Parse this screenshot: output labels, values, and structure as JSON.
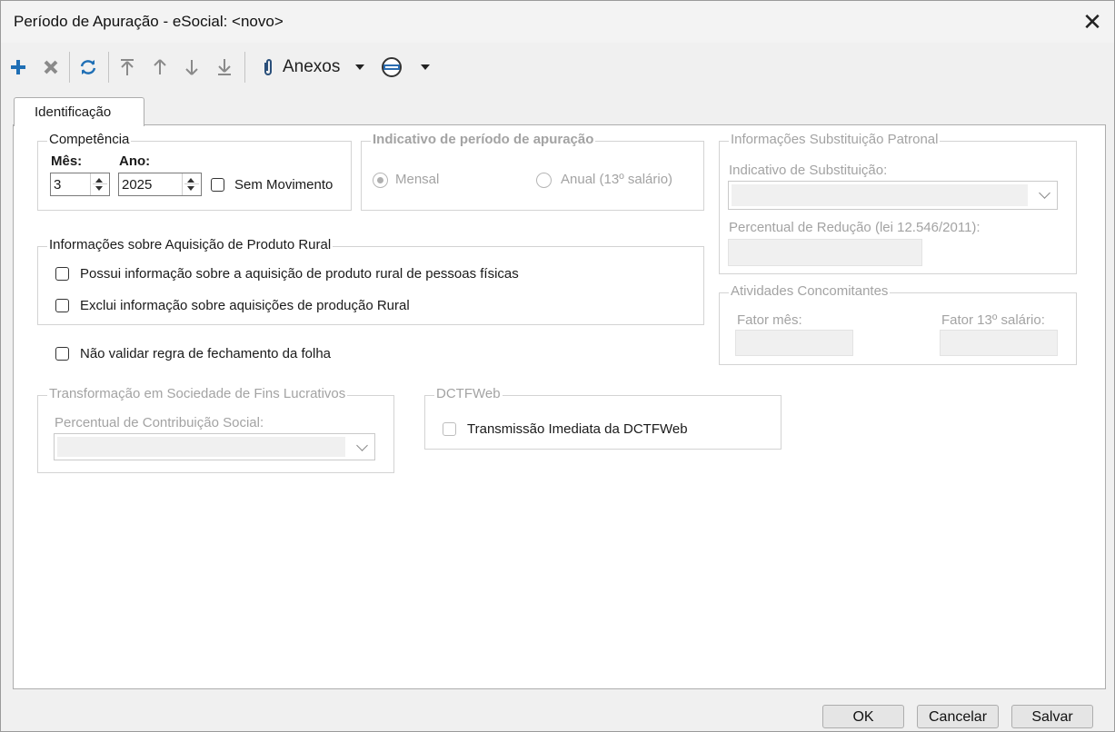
{
  "window": {
    "title": "Período de Apuração - eSocial: <novo>"
  },
  "toolbar": {
    "add_icon": "plus-icon",
    "delete_icon": "x-icon",
    "refresh_icon": "refresh-icon",
    "nav_icons": [
      "first-icon",
      "prev-icon",
      "next-icon",
      "last-icon"
    ],
    "anexos_label": "Anexos",
    "colors": {
      "add": "#1f6fb5",
      "refresh": "#1f6fb5"
    }
  },
  "tabs": [
    {
      "label": "Identificação",
      "active": true
    }
  ],
  "competencia": {
    "legend": "Competência",
    "mes_label": "Mês:",
    "mes_value": "3",
    "ano_label": "Ano:",
    "ano_value": "2025",
    "sem_movimento_label": "Sem Movimento",
    "sem_movimento_checked": false
  },
  "indicativo": {
    "legend": "Indicativo de período de apuração",
    "options": [
      {
        "label": "Mensal",
        "selected": true
      },
      {
        "label": "Anual (13º salário)",
        "selected": false
      }
    ]
  },
  "substituicao": {
    "legend": "Informações Substituição Patronal",
    "indicativo_label": "Indicativo de Substituição:",
    "indicativo_value": "",
    "percentual_label": "Percentual de Redução  (lei 12.546/2011):",
    "percentual_value": ""
  },
  "produto_rural": {
    "legend": "Informações sobre Aquisição de Produto Rural",
    "options": [
      {
        "label": "Possui informação sobre a aquisição de produto rural de pessoas físicas",
        "checked": false
      },
      {
        "label": "Exclui informação sobre aquisições de produção Rural",
        "checked": false
      }
    ]
  },
  "atividades": {
    "legend": "Atividades Concomitantes",
    "fator_mes_label": "Fator mês:",
    "fator_13_label": "Fator 13º salário:"
  },
  "nao_validar_label": "Não validar regra de fechamento da folha",
  "transformacao": {
    "legend": "Transformação em Sociedade de Fins Lucrativos",
    "percentual_label": "Percentual de Contribuição Social:",
    "percentual_value": ""
  },
  "dctfweb": {
    "legend": "DCTFWeb",
    "transmissao_label": "Transmissão Imediata da DCTFWeb",
    "transmissao_checked": false
  },
  "footer": {
    "ok_label": "OK",
    "cancel_label": "Cancelar",
    "save_label": "Salvar"
  }
}
